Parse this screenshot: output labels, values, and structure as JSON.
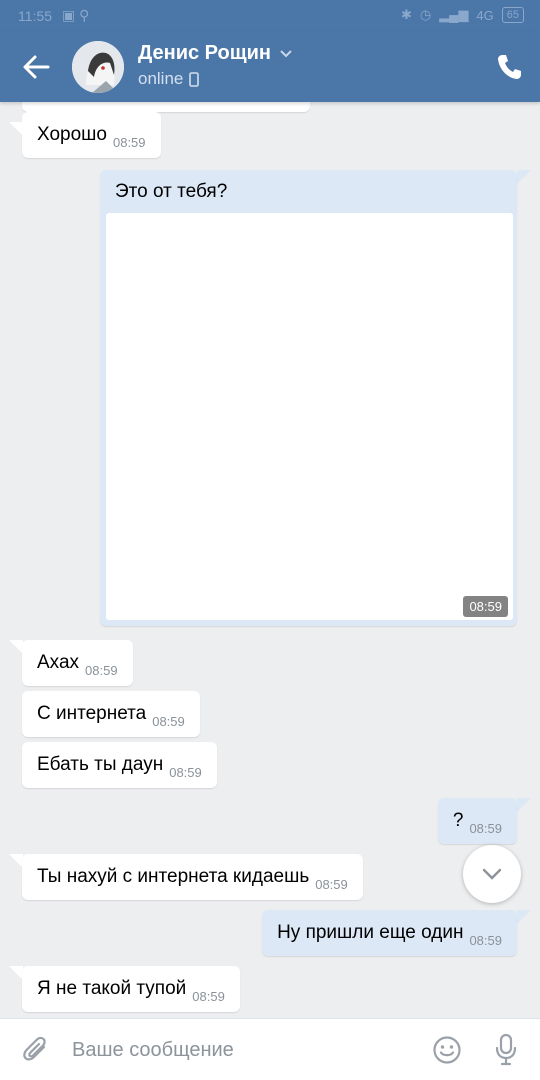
{
  "statusbar": {
    "time": "11:55",
    "network": "4G",
    "battery": "65"
  },
  "header": {
    "name": "Денис Рощин",
    "status": "online"
  },
  "messages": [
    {
      "dir": "in",
      "text": "Хорошо",
      "time": "08:59"
    },
    {
      "dir": "out",
      "text": "Это от тебя?",
      "time": "08:59",
      "has_image": true
    },
    {
      "dir": "in",
      "text": "Ахах",
      "time": "08:59"
    },
    {
      "dir": "in",
      "text": "С интернета",
      "time": "08:59"
    },
    {
      "dir": "in",
      "text": "Ебать ты даун",
      "time": "08:59"
    },
    {
      "dir": "out",
      "text": "?",
      "time": "08:59"
    },
    {
      "dir": "in",
      "text": "Ты нахуй с интернета кидаешь",
      "time": "08:59"
    },
    {
      "dir": "out",
      "text": "Ну пришли еще один",
      "time": "08:59"
    },
    {
      "dir": "in",
      "text": "Я не такой тупой",
      "time": "08:59"
    }
  ],
  "composer": {
    "placeholder": "Ваше сообщение"
  },
  "colors": {
    "header": "#4a76a8",
    "background": "#edeef0",
    "outgoing_bubble": "#dce8f6",
    "incoming_bubble": "#ffffff"
  }
}
